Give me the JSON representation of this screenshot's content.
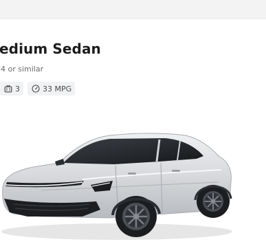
{
  "card": {
    "title": "edium Sedan",
    "subtitle": "4 or similar",
    "features": [
      {
        "icon": "luggage-icon",
        "value": "3"
      },
      {
        "icon": "fuel-gauge-icon",
        "value": "33 MPG"
      }
    ]
  },
  "image": {
    "subject": "car-image",
    "body_color": "#d9dadd"
  }
}
